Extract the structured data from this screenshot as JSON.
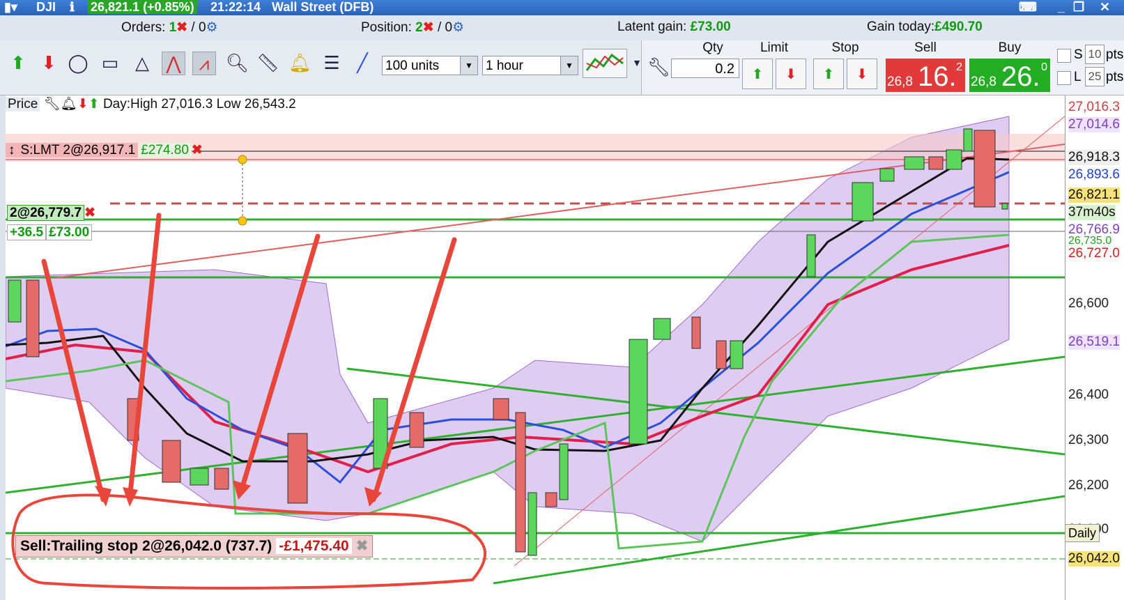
{
  "title": {
    "symbol": "DJI",
    "price": "26,821.1 (+0.85%)",
    "time": "21:22:14",
    "market": "Wall Street (DFB)"
  },
  "status": {
    "orders_label": "Orders:",
    "orders_count": "1",
    "orders_zero": "/ 0",
    "position_label": "Position:",
    "position_count": "2",
    "position_zero": "/ 0",
    "latent_label": "Latent gain:",
    "latent_value": "£73.00",
    "gain_label": "Gain today:",
    "gain_value": "£490.70"
  },
  "toolbar": {
    "units": "100 units",
    "interval": "1 hour"
  },
  "deal": {
    "qty_label": "Qty",
    "qty_value": "0.2",
    "limit_label": "Limit",
    "stop_label": "Stop",
    "sell_label": "Sell",
    "buy_label": "Buy",
    "sell_prefix": "26,8",
    "sell_big": "16.",
    "sell_sup": "2",
    "buy_prefix": "26,8",
    "buy_big": "26.",
    "buy_sup": "0",
    "s_label": "S",
    "s_pts": "10",
    "l_label": "L",
    "l_pts": "25",
    "pts": "pts"
  },
  "chart": {
    "price_label": "Price",
    "day_range": "Day:High 27,016.3 Low 26,543.2",
    "order_label": "S:LMT 2@26,917.1",
    "order_profit": "£274.80",
    "position_label": "2@26,779.7",
    "position_pts": "+36.5",
    "position_gain": "£73.00",
    "trailing_label": "Sell:Trailing stop 2@26,042.0 (737.7)",
    "trailing_loss": "-£1,475.40",
    "daily_tag": "Daily"
  },
  "axis": [
    {
      "text": "27,016.3",
      "color": "#d04040"
    },
    {
      "text": "27,014.6",
      "color": "#8040c0"
    },
    {
      "text": "26,918.3",
      "color": "#111111"
    },
    {
      "text": "26,893.6",
      "color": "#2040d0"
    },
    {
      "text": "26,821.1",
      "color": "#111111"
    },
    {
      "text": "37m40s",
      "color": "#111111"
    },
    {
      "text": "26,766.9",
      "color": "#8040c0"
    },
    {
      "text": "26,735.0",
      "color": "#20a020"
    },
    {
      "text": "26,727.0",
      "color": "#d02020"
    },
    {
      "text": "26,600",
      "color": "#222222"
    },
    {
      "text": "26,519.1",
      "color": "#8040c0"
    },
    {
      "text": "26,400",
      "color": "#222222"
    },
    {
      "text": "26,300",
      "color": "#222222"
    },
    {
      "text": "26,200",
      "color": "#222222"
    },
    {
      "text": "26,100",
      "color": "#222222"
    },
    {
      "text": "26,042.0",
      "color": "#111111"
    }
  ],
  "colors": {
    "sell": "#e03a3a",
    "buy": "#22ad22",
    "bollinger": "#b88ee0",
    "ma_black": "#111111",
    "ma_blue": "#2a4fd8",
    "ma_red": "#e0204a",
    "annotation": "#e8463a"
  },
  "icons": [
    "buy-arrow-icon",
    "sell-arrow-icon",
    "ellipse-tool-icon",
    "rectangle-tool-icon",
    "triangle-tool-icon",
    "trend-tool-icon",
    "channel-tool-icon",
    "zoom-icon",
    "ruler-icon",
    "alert-bell-icon",
    "fibonacci-icon",
    "line-tool-icon",
    "indicator-icon",
    "wrench-icon"
  ]
}
